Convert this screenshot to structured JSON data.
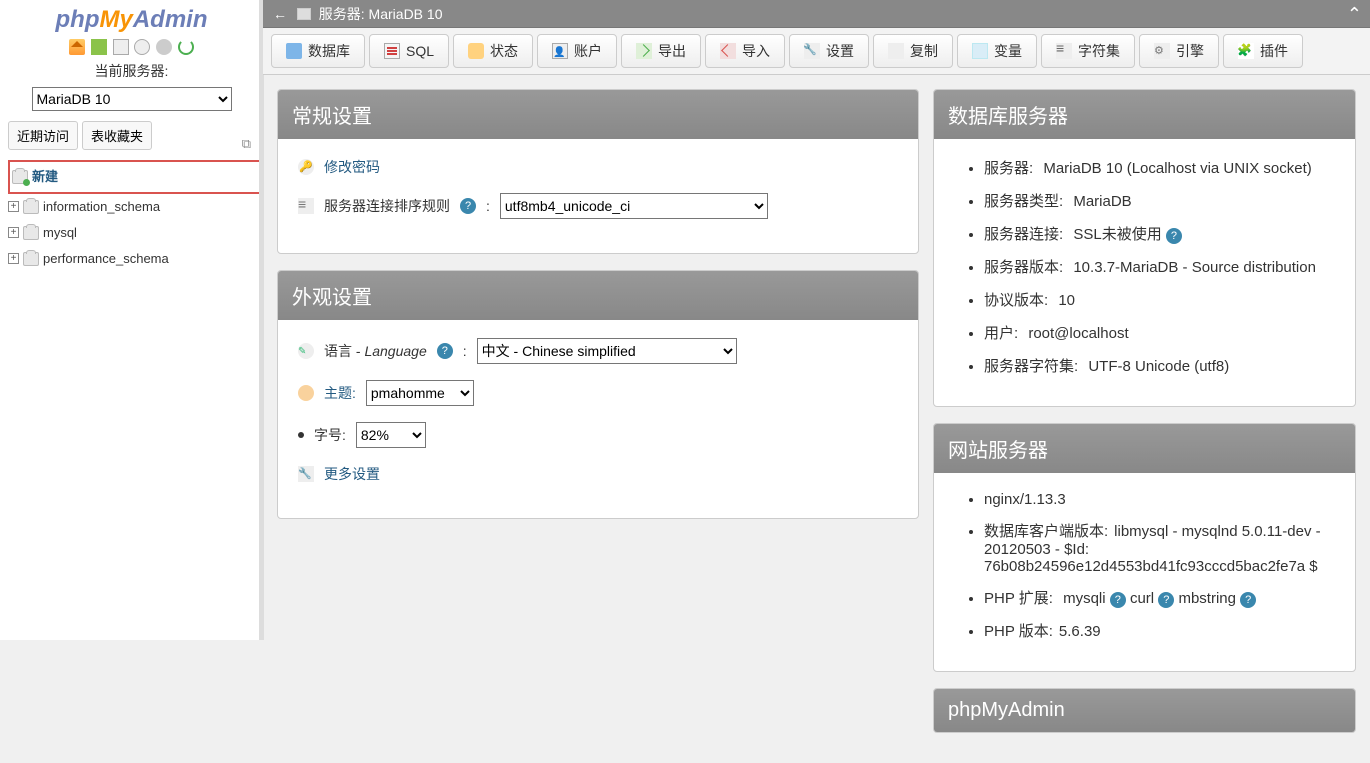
{
  "logo": {
    "php": "php",
    "my": "My",
    "admin": "Admin"
  },
  "sidebar": {
    "current_server_label": "当前服务器:",
    "selected_server": "MariaDB 10",
    "tabs": {
      "recent": "近期访问",
      "fav": "表收藏夹"
    },
    "tree": {
      "new": "新建",
      "items": [
        "information_schema",
        "mysql",
        "performance_schema"
      ]
    }
  },
  "serverinfo": {
    "label": "服务器: MariaDB 10"
  },
  "topmenu": {
    "db": "数据库",
    "sql": "SQL",
    "status": "状态",
    "users": "账户",
    "export": "导出",
    "import": "导入",
    "settings": "设置",
    "replication": "复制",
    "variables": "变量",
    "charset": "字符集",
    "engines": "引擎",
    "plugins": "插件"
  },
  "general": {
    "title": "常规设置",
    "change_pw": "修改密码",
    "collation_label": "服务器连接排序规则",
    "collation_value": "utf8mb4_unicode_ci"
  },
  "appearance": {
    "title": "外观设置",
    "lang_label_cn": "语言",
    "lang_label_en": "Language",
    "lang_value": "中文 - Chinese simplified",
    "theme_label": "主题:",
    "theme_value": "pmahomme",
    "fontsize_label": "字号:",
    "fontsize_value": "82%",
    "more": "更多设置"
  },
  "dbserver": {
    "title": "数据库服务器",
    "items": [
      {
        "k": "服务器:",
        "v": "MariaDB 10 (Localhost via UNIX socket)"
      },
      {
        "k": "服务器类型:",
        "v": "MariaDB"
      },
      {
        "k": "服务器连接:",
        "v": "SSL未被使用",
        "help": true
      },
      {
        "k": "服务器版本:",
        "v": "10.3.7-MariaDB - Source distribution"
      },
      {
        "k": "协议版本:",
        "v": "10"
      },
      {
        "k": "用户:",
        "v": "root@localhost"
      },
      {
        "k": "服务器字符集:",
        "v": "UTF-8 Unicode (utf8)"
      }
    ]
  },
  "webserver": {
    "title": "网站服务器",
    "software": "nginx/1.13.3",
    "client_label": "数据库客户端版本:",
    "client_value": "libmysql - mysqlnd 5.0.11-dev - 20120503 - $Id: 76b08b24596e12d4553bd41fc93cccd5bac2fe7a $",
    "phpext_label": "PHP 扩展:",
    "phpext": [
      "mysqli",
      "curl",
      "mbstring"
    ],
    "phpver_label": "PHP 版本:",
    "phpver": "5.6.39"
  },
  "pma": {
    "title": "phpMyAdmin"
  }
}
